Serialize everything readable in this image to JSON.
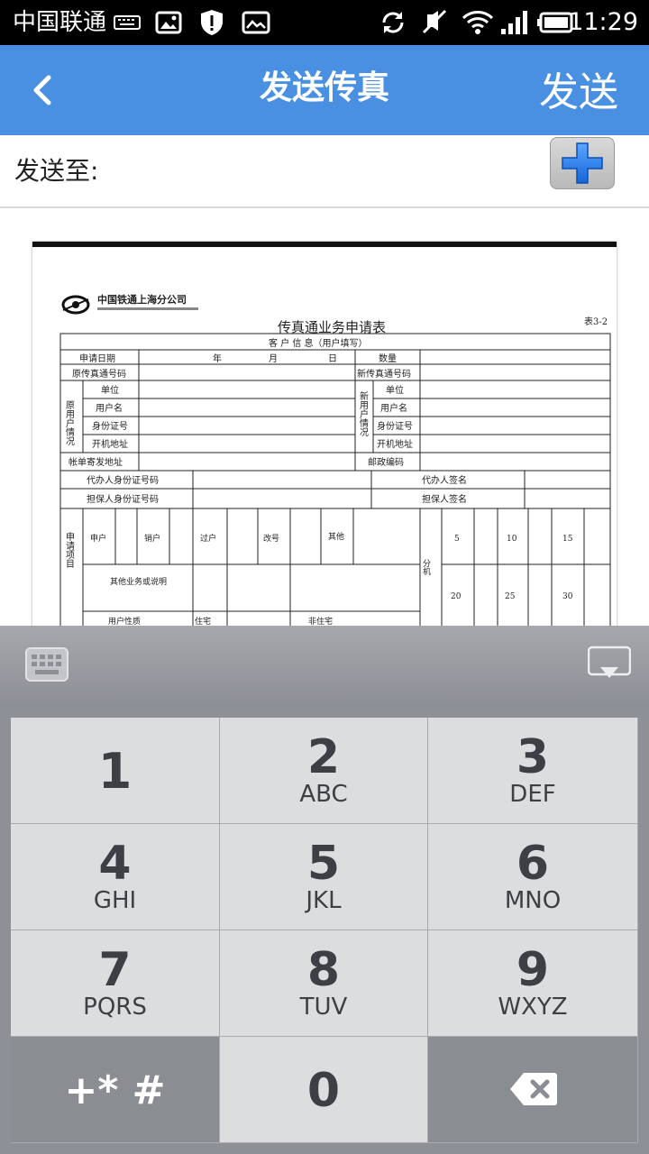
{
  "status_bar": {
    "carrier": "中国联通",
    "time": "11:29",
    "icons": [
      "keyboard-icon",
      "image-icon",
      "shield-alert-icon",
      "gallery-icon",
      "sync-icon",
      "mute-icon",
      "wifi-icon",
      "signal-icon",
      "battery-icon"
    ]
  },
  "header": {
    "back_icon": "chevron-left-icon",
    "title": "发送传真",
    "send_label": "发送",
    "color": "#4a90e2"
  },
  "recipient": {
    "label": "发送至:",
    "add_icon": "plus-icon"
  },
  "document": {
    "company": "中国铁通上海分公司",
    "form_title": "传真通业务申请表",
    "table_no": "表3-2",
    "section": "客 户 信 息（用户填写）",
    "rows": [
      [
        "申请日期",
        "年",
        "月",
        "日",
        "数量"
      ],
      [
        "原传真通号码",
        "新传真通号码"
      ],
      [
        "单位",
        "单位"
      ],
      [
        "用户名",
        "用户名"
      ],
      [
        "身份证号",
        "身份证号"
      ],
      [
        "开机地址",
        "开机地址"
      ],
      [
        "帐单寄发地址",
        "邮政编码"
      ],
      [
        "代办人身份证号码",
        "代办人签名"
      ],
      [
        "担保人身份证号码",
        "担保人签名"
      ]
    ],
    "group_left": "原用户情况",
    "group_right": "新用户情况",
    "apply_items_label": "申请项目",
    "apply_items": [
      "申户",
      "销户",
      "过户",
      "改号",
      "其他"
    ],
    "other_label": "其他业务或说明",
    "extension_label": "分机",
    "extension_values": [
      "5",
      "10",
      "15",
      "20",
      "25",
      "30"
    ],
    "user_type_label": "用户性质",
    "user_types": [
      "住宅",
      "非住宅"
    ]
  },
  "keyboard": {
    "keys": [
      {
        "num": "1",
        "letters": ""
      },
      {
        "num": "2",
        "letters": "ABC"
      },
      {
        "num": "3",
        "letters": "DEF"
      },
      {
        "num": "4",
        "letters": "GHI"
      },
      {
        "num": "5",
        "letters": "JKL"
      },
      {
        "num": "6",
        "letters": "MNO"
      },
      {
        "num": "7",
        "letters": "PQRS"
      },
      {
        "num": "8",
        "letters": "TUV"
      },
      {
        "num": "9",
        "letters": "WXYZ"
      }
    ],
    "symbols_label": "+* #",
    "zero_label": "0",
    "icons": [
      "keyboard-switch-icon",
      "hide-keyboard-icon",
      "backspace-icon"
    ]
  }
}
